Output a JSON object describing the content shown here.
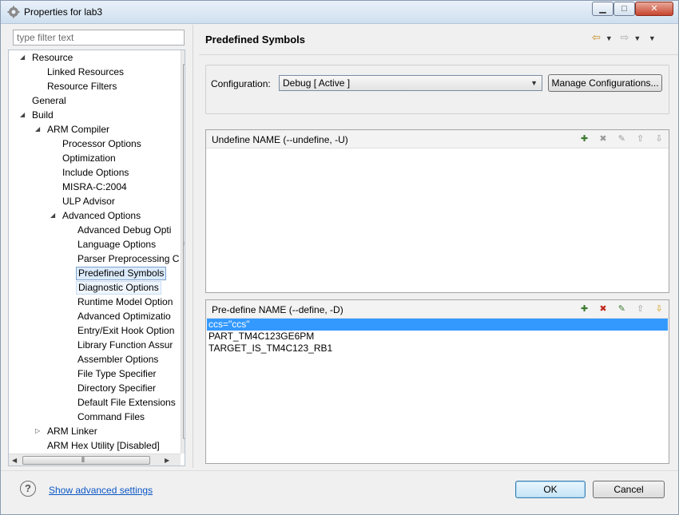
{
  "window": {
    "title": "Properties for lab3",
    "min": "▁",
    "max": "□",
    "close": "✕"
  },
  "filter": {
    "placeholder": "type filter text"
  },
  "tree": [
    {
      "label": "Resource",
      "level": 0,
      "expanded": true
    },
    {
      "label": "Linked Resources",
      "level": 1
    },
    {
      "label": "Resource Filters",
      "level": 1
    },
    {
      "label": "General",
      "level": 0
    },
    {
      "label": "Build",
      "level": 0,
      "expanded": true
    },
    {
      "label": "ARM Compiler",
      "level": 1,
      "expanded": true
    },
    {
      "label": "Processor Options",
      "level": 2
    },
    {
      "label": "Optimization",
      "level": 2
    },
    {
      "label": "Include Options",
      "level": 2
    },
    {
      "label": "MISRA-C:2004",
      "level": 2
    },
    {
      "label": "ULP Advisor",
      "level": 2
    },
    {
      "label": "Advanced Options",
      "level": 2,
      "expanded": true
    },
    {
      "label": "Advanced Debug Opti",
      "level": 3
    },
    {
      "label": "Language Options",
      "level": 3
    },
    {
      "label": "Parser Preprocessing C",
      "level": 3
    },
    {
      "label": "Predefined Symbols",
      "level": 3,
      "selected": true
    },
    {
      "label": "Diagnostic Options",
      "level": 3,
      "hover": true
    },
    {
      "label": "Runtime Model Option",
      "level": 3
    },
    {
      "label": "Advanced Optimizatio",
      "level": 3
    },
    {
      "label": "Entry/Exit Hook Option",
      "level": 3
    },
    {
      "label": "Library Function Assur",
      "level": 3
    },
    {
      "label": "Assembler Options",
      "level": 3
    },
    {
      "label": "File Type Specifier",
      "level": 3
    },
    {
      "label": "Directory Specifier",
      "level": 3
    },
    {
      "label": "Default File Extensions",
      "level": 3
    },
    {
      "label": "Command Files",
      "level": 3
    },
    {
      "label": "ARM Linker",
      "level": 1,
      "collapsed": true
    },
    {
      "label": "ARM Hex Utility  [Disabled]",
      "level": 1
    }
  ],
  "page": {
    "title": "Predefined Symbols"
  },
  "config": {
    "label": "Configuration:",
    "value": "Debug  [ Active ]",
    "manage": "Manage Configurations..."
  },
  "undefine": {
    "title": "Undefine NAME (--undefine, -U)",
    "items": []
  },
  "predefine": {
    "title": "Pre-define NAME (--define, -D)",
    "items": [
      "ccs=\"ccs\"",
      "PART_TM4C123GE6PM",
      "TARGET_IS_TM4C123_RB1"
    ]
  },
  "footer": {
    "help": "?",
    "advanced": "Show advanced settings",
    "ok": "OK",
    "cancel": "Cancel"
  }
}
